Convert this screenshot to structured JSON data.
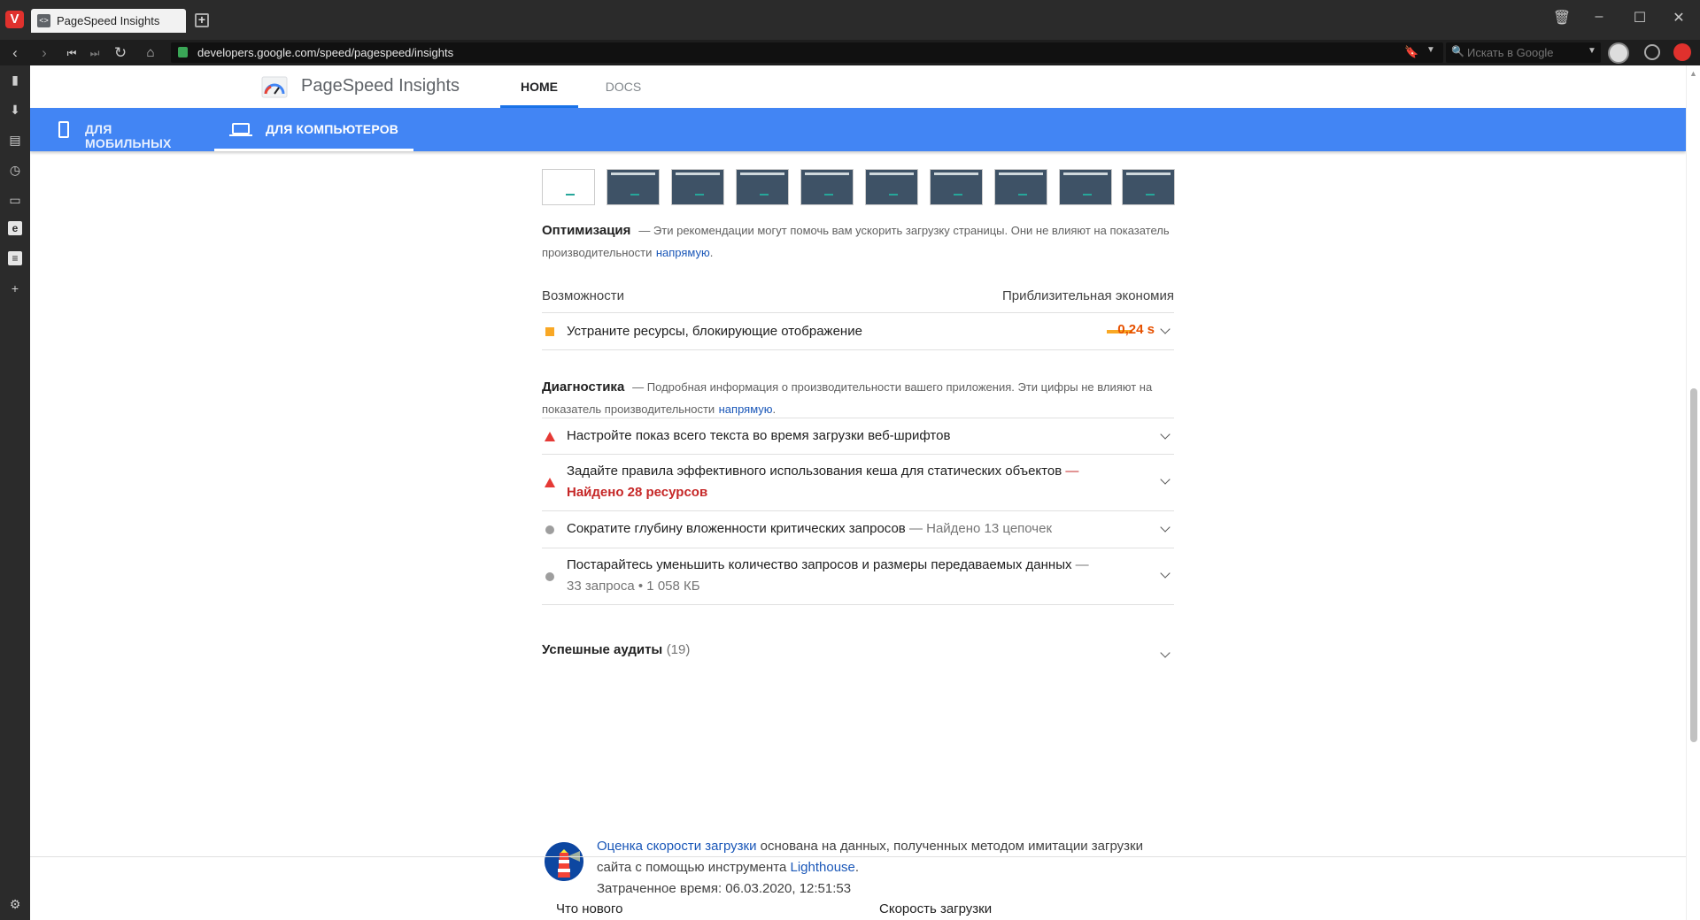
{
  "browser": {
    "tab_title": "PageSpeed Insights",
    "url": "developers.google.com/speed/pagespeed/insights",
    "search_placeholder": "Искать в Google"
  },
  "header": {
    "title": "PageSpeed Insights",
    "nav_home": "HOME",
    "nav_docs": "DOCS"
  },
  "device_tabs": {
    "mobile": "ДЛЯ МОБИЛЬНЫХ",
    "desktop": "ДЛЯ КОМПЬЮТЕРОВ"
  },
  "optimization": {
    "title": "Оптимизация",
    "desc": "— Эти рекомендации могут помочь вам ускорить загрузку страницы. Они не влияют на показатель производительности",
    "link": "напрямую",
    "col_left": "Возможности",
    "col_right": "Приблизительная экономия",
    "items": [
      {
        "label": "Устраните ресурсы, блокирующие отображение",
        "savings": "0,24 s"
      }
    ]
  },
  "diagnostics": {
    "title": "Диагностика",
    "desc": "— Подробная информация о производительности вашего приложения. Эти цифры не влияют на показатель производительности",
    "link": "напрямую",
    "items": [
      {
        "label": "Настройте показ всего текста во время загрузки веб-шрифтов"
      },
      {
        "label": "Задайте правила эффективного использования кеша для статических объектов",
        "sep": "—",
        "detail": "Найдено 28 ресурсов"
      },
      {
        "label": "Сократите глубину вложенности критических запросов",
        "detail": "— Найдено 13 цепочек"
      },
      {
        "label": "Постарайтесь уменьшить количество запросов и размеры передаваемых данных",
        "sep": "—",
        "detail": "33 запроса • 1 058 КБ"
      }
    ]
  },
  "passed": {
    "title": "Успешные аудиты",
    "count": "(19)"
  },
  "lighthouse": {
    "link1": "Оценка скорости загрузки",
    "text1": "основана на данных, полученных методом имитации загрузки сайта с помощью инструмента",
    "link2": "Lighthouse",
    "time_label": "Затраченное время: 06.03.2020, 12:51:53"
  },
  "footer": {
    "col1": "Что нового",
    "col2": "Скорость загрузки"
  },
  "colors": {
    "accent_blue": "#4285f4",
    "warn_orange": "#f9a825",
    "fail_red": "#e53935"
  }
}
